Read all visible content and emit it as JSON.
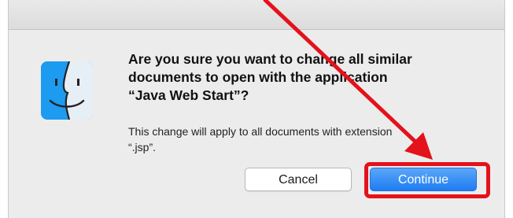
{
  "dialog": {
    "headline_lines": [
      "Are you sure you want to change all similar",
      "documents to open with the application",
      "“Java Web Start”?"
    ],
    "body_lines": [
      "This change will apply to all documents with extension",
      "“.jsp”."
    ],
    "cancel_label": "Cancel",
    "continue_label": "Continue",
    "icon": "finder-icon"
  },
  "annotation": {
    "arrow_color": "#e3121b",
    "highlight_color": "#e3121b"
  },
  "colors": {
    "accent": "#1e7cf2",
    "window_bg": "#ececec"
  }
}
